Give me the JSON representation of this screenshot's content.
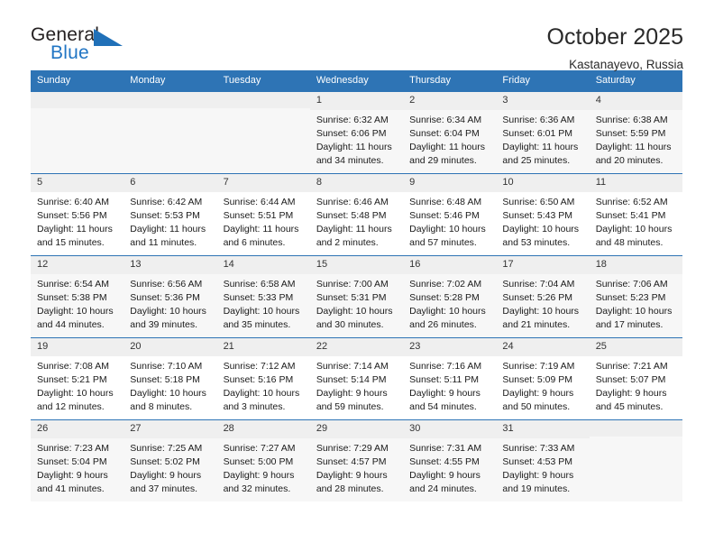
{
  "brand": {
    "name_top": "General",
    "name_bottom": "Blue",
    "accent_color": "#2070b8",
    "triangle_icon": "triangle-icon"
  },
  "header": {
    "title": "October 2025",
    "location": "Kastanayevo, Russia"
  },
  "colors": {
    "header_blue": "#2e74b5",
    "daynum_band": "#efefef",
    "row_shade": "#f7f7f7",
    "text": "#1a1a1a"
  },
  "calendar": {
    "weekday_headers": [
      "Sunday",
      "Monday",
      "Tuesday",
      "Wednesday",
      "Thursday",
      "Friday",
      "Saturday"
    ],
    "labels": {
      "sunrise": "Sunrise:",
      "sunset": "Sunset:",
      "daylight": "Daylight:"
    },
    "weeks": [
      [
        {
          "day": "",
          "empty": true
        },
        {
          "day": "",
          "empty": true
        },
        {
          "day": "",
          "empty": true
        },
        {
          "day": "1",
          "sunrise": "Sunrise: 6:32 AM",
          "sunset": "Sunset: 6:06 PM",
          "daylight_line1": "Daylight: 11 hours",
          "daylight_line2": "and 34 minutes."
        },
        {
          "day": "2",
          "sunrise": "Sunrise: 6:34 AM",
          "sunset": "Sunset: 6:04 PM",
          "daylight_line1": "Daylight: 11 hours",
          "daylight_line2": "and 29 minutes."
        },
        {
          "day": "3",
          "sunrise": "Sunrise: 6:36 AM",
          "sunset": "Sunset: 6:01 PM",
          "daylight_line1": "Daylight: 11 hours",
          "daylight_line2": "and 25 minutes."
        },
        {
          "day": "4",
          "sunrise": "Sunrise: 6:38 AM",
          "sunset": "Sunset: 5:59 PM",
          "daylight_line1": "Daylight: 11 hours",
          "daylight_line2": "and 20 minutes."
        }
      ],
      [
        {
          "day": "5",
          "sunrise": "Sunrise: 6:40 AM",
          "sunset": "Sunset: 5:56 PM",
          "daylight_line1": "Daylight: 11 hours",
          "daylight_line2": "and 15 minutes."
        },
        {
          "day": "6",
          "sunrise": "Sunrise: 6:42 AM",
          "sunset": "Sunset: 5:53 PM",
          "daylight_line1": "Daylight: 11 hours",
          "daylight_line2": "and 11 minutes."
        },
        {
          "day": "7",
          "sunrise": "Sunrise: 6:44 AM",
          "sunset": "Sunset: 5:51 PM",
          "daylight_line1": "Daylight: 11 hours",
          "daylight_line2": "and 6 minutes."
        },
        {
          "day": "8",
          "sunrise": "Sunrise: 6:46 AM",
          "sunset": "Sunset: 5:48 PM",
          "daylight_line1": "Daylight: 11 hours",
          "daylight_line2": "and 2 minutes."
        },
        {
          "day": "9",
          "sunrise": "Sunrise: 6:48 AM",
          "sunset": "Sunset: 5:46 PM",
          "daylight_line1": "Daylight: 10 hours",
          "daylight_line2": "and 57 minutes."
        },
        {
          "day": "10",
          "sunrise": "Sunrise: 6:50 AM",
          "sunset": "Sunset: 5:43 PM",
          "daylight_line1": "Daylight: 10 hours",
          "daylight_line2": "and 53 minutes."
        },
        {
          "day": "11",
          "sunrise": "Sunrise: 6:52 AM",
          "sunset": "Sunset: 5:41 PM",
          "daylight_line1": "Daylight: 10 hours",
          "daylight_line2": "and 48 minutes."
        }
      ],
      [
        {
          "day": "12",
          "sunrise": "Sunrise: 6:54 AM",
          "sunset": "Sunset: 5:38 PM",
          "daylight_line1": "Daylight: 10 hours",
          "daylight_line2": "and 44 minutes."
        },
        {
          "day": "13",
          "sunrise": "Sunrise: 6:56 AM",
          "sunset": "Sunset: 5:36 PM",
          "daylight_line1": "Daylight: 10 hours",
          "daylight_line2": "and 39 minutes."
        },
        {
          "day": "14",
          "sunrise": "Sunrise: 6:58 AM",
          "sunset": "Sunset: 5:33 PM",
          "daylight_line1": "Daylight: 10 hours",
          "daylight_line2": "and 35 minutes."
        },
        {
          "day": "15",
          "sunrise": "Sunrise: 7:00 AM",
          "sunset": "Sunset: 5:31 PM",
          "daylight_line1": "Daylight: 10 hours",
          "daylight_line2": "and 30 minutes."
        },
        {
          "day": "16",
          "sunrise": "Sunrise: 7:02 AM",
          "sunset": "Sunset: 5:28 PM",
          "daylight_line1": "Daylight: 10 hours",
          "daylight_line2": "and 26 minutes."
        },
        {
          "day": "17",
          "sunrise": "Sunrise: 7:04 AM",
          "sunset": "Sunset: 5:26 PM",
          "daylight_line1": "Daylight: 10 hours",
          "daylight_line2": "and 21 minutes."
        },
        {
          "day": "18",
          "sunrise": "Sunrise: 7:06 AM",
          "sunset": "Sunset: 5:23 PM",
          "daylight_line1": "Daylight: 10 hours",
          "daylight_line2": "and 17 minutes."
        }
      ],
      [
        {
          "day": "19",
          "sunrise": "Sunrise: 7:08 AM",
          "sunset": "Sunset: 5:21 PM",
          "daylight_line1": "Daylight: 10 hours",
          "daylight_line2": "and 12 minutes."
        },
        {
          "day": "20",
          "sunrise": "Sunrise: 7:10 AM",
          "sunset": "Sunset: 5:18 PM",
          "daylight_line1": "Daylight: 10 hours",
          "daylight_line2": "and 8 minutes."
        },
        {
          "day": "21",
          "sunrise": "Sunrise: 7:12 AM",
          "sunset": "Sunset: 5:16 PM",
          "daylight_line1": "Daylight: 10 hours",
          "daylight_line2": "and 3 minutes."
        },
        {
          "day": "22",
          "sunrise": "Sunrise: 7:14 AM",
          "sunset": "Sunset: 5:14 PM",
          "daylight_line1": "Daylight: 9 hours",
          "daylight_line2": "and 59 minutes."
        },
        {
          "day": "23",
          "sunrise": "Sunrise: 7:16 AM",
          "sunset": "Sunset: 5:11 PM",
          "daylight_line1": "Daylight: 9 hours",
          "daylight_line2": "and 54 minutes."
        },
        {
          "day": "24",
          "sunrise": "Sunrise: 7:19 AM",
          "sunset": "Sunset: 5:09 PM",
          "daylight_line1": "Daylight: 9 hours",
          "daylight_line2": "and 50 minutes."
        },
        {
          "day": "25",
          "sunrise": "Sunrise: 7:21 AM",
          "sunset": "Sunset: 5:07 PM",
          "daylight_line1": "Daylight: 9 hours",
          "daylight_line2": "and 45 minutes."
        }
      ],
      [
        {
          "day": "26",
          "sunrise": "Sunrise: 7:23 AM",
          "sunset": "Sunset: 5:04 PM",
          "daylight_line1": "Daylight: 9 hours",
          "daylight_line2": "and 41 minutes."
        },
        {
          "day": "27",
          "sunrise": "Sunrise: 7:25 AM",
          "sunset": "Sunset: 5:02 PM",
          "daylight_line1": "Daylight: 9 hours",
          "daylight_line2": "and 37 minutes."
        },
        {
          "day": "28",
          "sunrise": "Sunrise: 7:27 AM",
          "sunset": "Sunset: 5:00 PM",
          "daylight_line1": "Daylight: 9 hours",
          "daylight_line2": "and 32 minutes."
        },
        {
          "day": "29",
          "sunrise": "Sunrise: 7:29 AM",
          "sunset": "Sunset: 4:57 PM",
          "daylight_line1": "Daylight: 9 hours",
          "daylight_line2": "and 28 minutes."
        },
        {
          "day": "30",
          "sunrise": "Sunrise: 7:31 AM",
          "sunset": "Sunset: 4:55 PM",
          "daylight_line1": "Daylight: 9 hours",
          "daylight_line2": "and 24 minutes."
        },
        {
          "day": "31",
          "sunrise": "Sunrise: 7:33 AM",
          "sunset": "Sunset: 4:53 PM",
          "daylight_line1": "Daylight: 9 hours",
          "daylight_line2": "and 19 minutes."
        },
        {
          "day": "",
          "empty": true
        }
      ]
    ]
  }
}
